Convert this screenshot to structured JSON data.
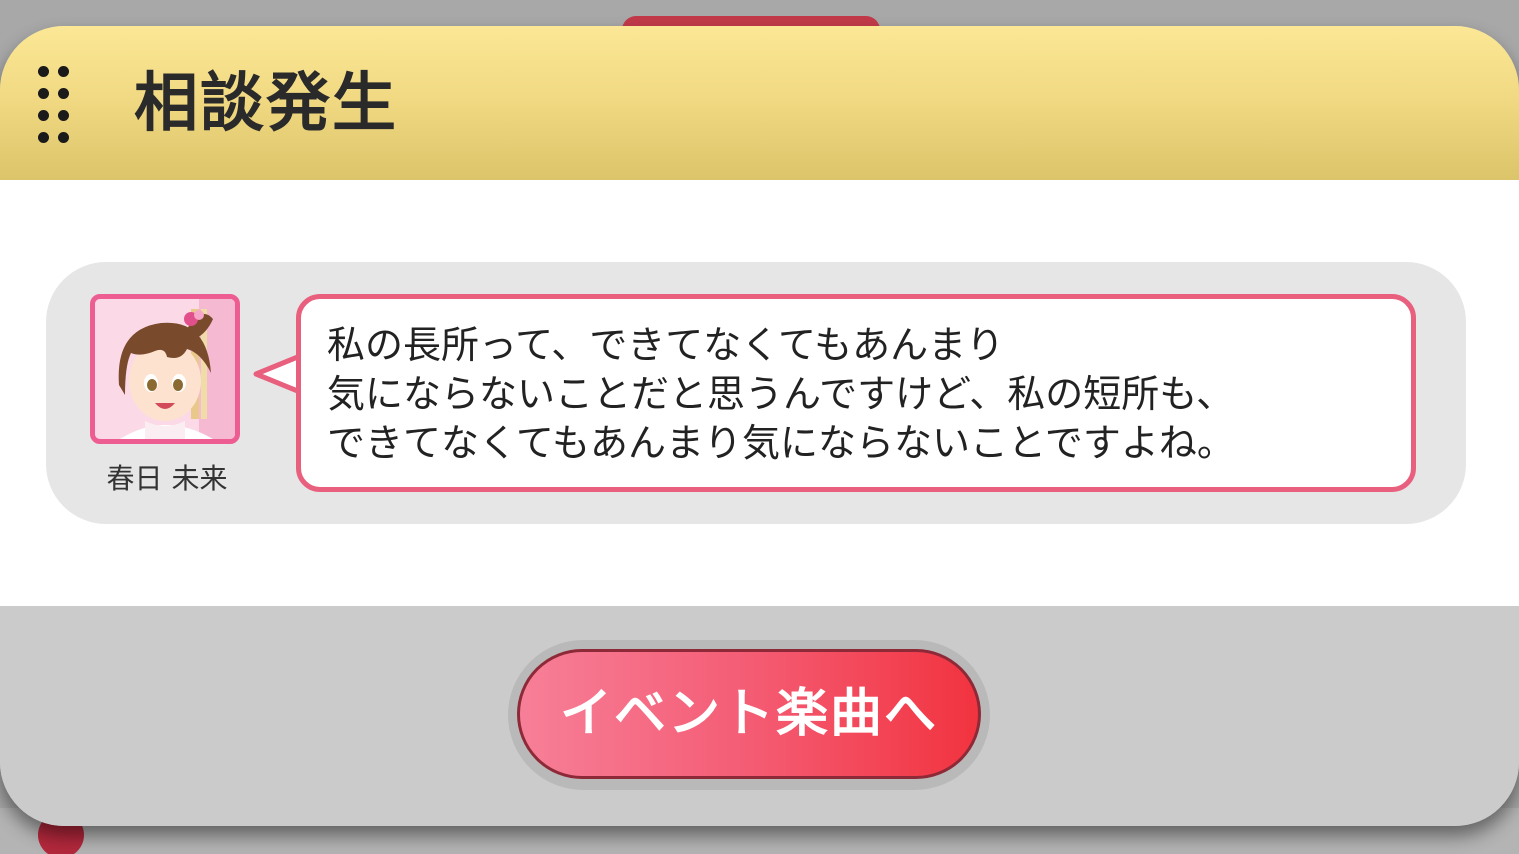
{
  "dialog": {
    "title": "相談発生"
  },
  "message": {
    "speaker": "春日 未来",
    "text": "私の長所って、できてなくてもあんまり\n気にならないことだと思うんですけど、私の短所も、\nできてなくてもあんまり気にならないことですよね。"
  },
  "actions": {
    "primary_label": "イベント楽曲へ"
  },
  "colors": {
    "header_gradient_top": "#fbe795",
    "header_gradient_bottom": "#dcc46a",
    "bubble_border": "#e8607d",
    "avatar_border": "#ee5d91",
    "button_gradient_left": "#f77f98",
    "button_gradient_right": "#f2333f"
  },
  "icons": {
    "drag_handle": "drag-handle-icon",
    "avatar": "character-avatar"
  }
}
